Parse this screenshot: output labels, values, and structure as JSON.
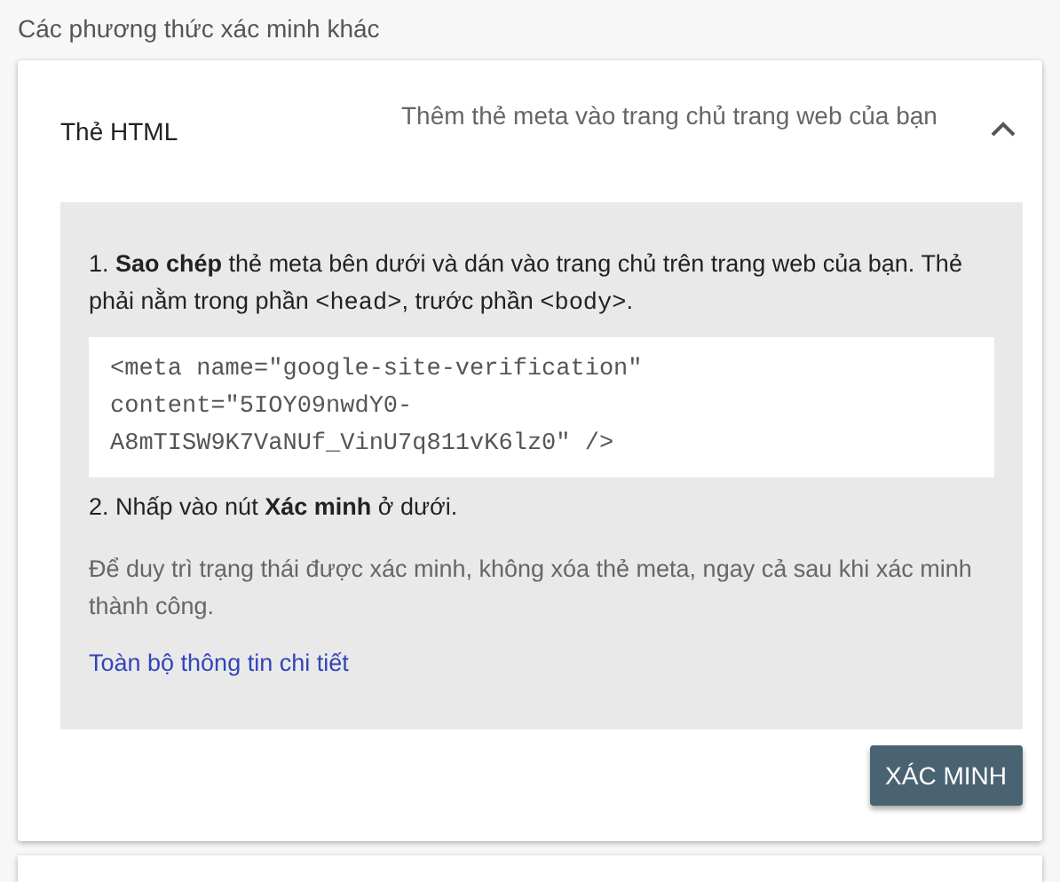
{
  "section_title": "Các phương thức xác minh khác",
  "method": {
    "name": "Thẻ HTML",
    "description": "Thêm thẻ meta vào trang chủ trang web của bạn",
    "expanded": true,
    "steps": [
      {
        "kind": "instruction",
        "segments": [
          {
            "kind": "text",
            "text": "1. "
          },
          {
            "kind": "bold",
            "text": "Sao chép"
          },
          {
            "kind": "text",
            "text": " thẻ meta bên dưới và dán vào trang chủ trên trang web của bạn. Thẻ phải nằm trong phần "
          },
          {
            "kind": "code",
            "text": "<head>"
          },
          {
            "kind": "text",
            "text": ", trước phần "
          },
          {
            "kind": "code",
            "text": "<body>"
          },
          {
            "kind": "text",
            "text": "."
          }
        ]
      },
      {
        "kind": "code_block",
        "lines": [
          "<meta name=\"google-site-verification\"",
          "content=\"5IOY09nwdY0-",
          "A8mTISW9K7VaNUf_VinU7q811vK6lz0\" />"
        ]
      },
      {
        "kind": "instruction",
        "segments": [
          {
            "kind": "text",
            "text": "2. Nhấp vào nút "
          },
          {
            "kind": "bold",
            "text": "Xác minh"
          },
          {
            "kind": "text",
            "text": " ở dưới."
          }
        ]
      },
      {
        "kind": "note",
        "text": "Để duy trì trạng thái được xác minh, không xóa thẻ meta, ngay cả sau khi xác minh thành công."
      },
      {
        "kind": "link",
        "text": "Toàn bộ thông tin chi tiết"
      }
    ],
    "verify_button": "XÁC MINH"
  }
}
